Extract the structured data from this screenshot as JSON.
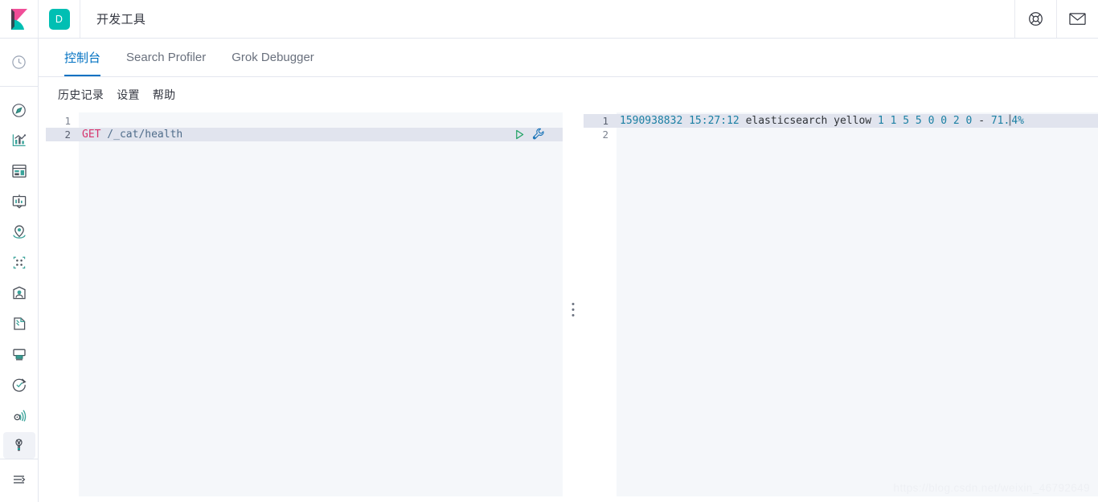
{
  "header": {
    "logo_icon": "kibana-logo-icon",
    "space_badge": "D",
    "title": "开发工具",
    "help_icon": "help-lifebuoy-icon",
    "newsfeed_icon": "envelope-icon"
  },
  "sidebar": {
    "items": [
      {
        "name": "recently-viewed",
        "icon": "clock-icon",
        "selected": false
      },
      {
        "name": "discover",
        "icon": "compass-icon",
        "selected": false
      },
      {
        "name": "visualize",
        "icon": "bar-chart-icon",
        "selected": false
      },
      {
        "name": "dashboard",
        "icon": "dashboard-icon",
        "selected": false
      },
      {
        "name": "canvas",
        "icon": "presentation-icon",
        "selected": false
      },
      {
        "name": "maps",
        "icon": "map-marker-icon",
        "selected": false
      },
      {
        "name": "machine-learning",
        "icon": "machine-learning-icon",
        "selected": false
      },
      {
        "name": "infrastructure",
        "icon": "user-icon",
        "selected": false
      },
      {
        "name": "logs",
        "icon": "logs-icon",
        "selected": false
      },
      {
        "name": "apm",
        "icon": "apm-icon",
        "selected": false
      },
      {
        "name": "uptime",
        "icon": "uptime-check-icon",
        "selected": false
      },
      {
        "name": "siem",
        "icon": "siem-icon",
        "selected": false
      },
      {
        "name": "dev-tools",
        "icon": "wrench-icon",
        "selected": true
      },
      {
        "name": "collapse-nav",
        "icon": "menu-arrow-icon",
        "selected": false
      }
    ]
  },
  "tabs": [
    {
      "label": "控制台",
      "active": true
    },
    {
      "label": "Search Profiler",
      "active": false
    },
    {
      "label": "Grok Debugger",
      "active": false
    }
  ],
  "submenu": [
    {
      "label": "历史记录"
    },
    {
      "label": "设置"
    },
    {
      "label": "帮助"
    }
  ],
  "request_editor": {
    "line_numbers": [
      "1",
      "2"
    ],
    "lines": [
      {
        "method": "",
        "path": ""
      },
      {
        "method": "GET",
        "path": " /_cat/health"
      }
    ],
    "active_line": 2,
    "play_icon": "play-triangle-icon",
    "wrench_icon": "wrench-icon"
  },
  "response_editor": {
    "line_numbers": [
      "1",
      "2"
    ],
    "response_line": {
      "epoch": "1590938832",
      "sep1": " ",
      "timestamp": "15:27:12",
      "sep2": " ",
      "cluster": "elasticsearch",
      "sep3": " ",
      "status": "yellow",
      "sep4": " ",
      "node_total": "1",
      "node_data": "1",
      "shards": "5",
      "pri": "5",
      "relo": "0",
      "init": "0",
      "unassign": "2",
      "pending_tasks": "0",
      "max_task_wait_time": "-",
      "active_shards_percent_head": "71.",
      "active_shards_percent_tail": "4%"
    },
    "active_line": 1
  },
  "splitter": {
    "grip_icon": "drag-handle-dots-icon"
  },
  "watermark": "https://blog.csdn.net/weixin_46792649",
  "colors": {
    "accent_blue": "#0071c2",
    "teal": "#00bfb3",
    "pink": "#f04e98",
    "method": "#d6336c",
    "number": "#1a7fa3",
    "highlight": "#e1e4ee",
    "editor_bg": "#f5f7fa"
  }
}
